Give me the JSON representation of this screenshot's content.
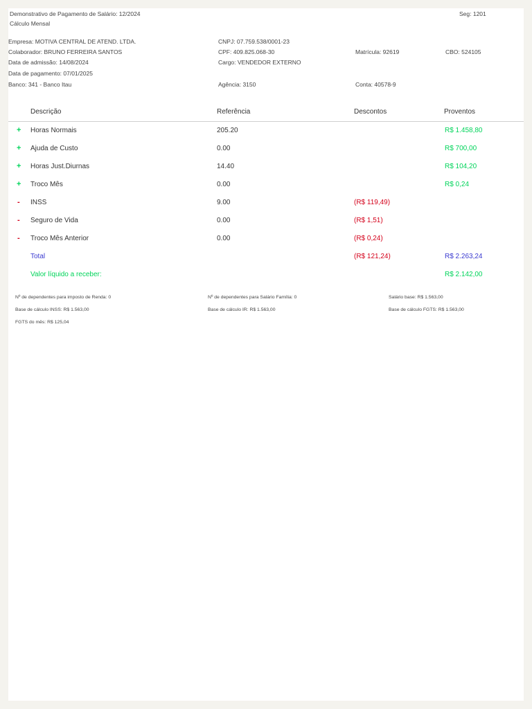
{
  "header": {
    "title": "Demonstrativo de Pagamento de Salário: 12/2024",
    "subtitle": "Cálculo Mensal",
    "seg": "Seg: 1201"
  },
  "info": {
    "empresa": "Empresa: MOTIVA CENTRAL DE ATEND. LTDA.",
    "cnpj": "CNPJ: 07.759.538/0001-23",
    "colaborador": "Colaborador: BRUNO FERREIRA SANTOS",
    "cpf": "CPF: 409.825.068-30",
    "matricula": "Matrícula: 92619",
    "cbo": "CBO: 524105",
    "admissao": "Data de admissão: 14/08/2024",
    "cargo": "Cargo: VENDEDOR EXTERNO",
    "pagamento": "Data de pagamento: 07/01/2025",
    "banco": "Banco: 341 - Banco Itau",
    "agencia": "Agência: 3150",
    "conta": "Conta: 40578-9"
  },
  "table": {
    "headers": {
      "descricao": "Descrição",
      "referencia": "Referência",
      "descontos": "Descontos",
      "proventos": "Proventos"
    },
    "rows": [
      {
        "sign": "+",
        "desc": "Horas Normais",
        "ref": "205.20",
        "desconto": "",
        "provento": "R$ 1.458,80"
      },
      {
        "sign": "+",
        "desc": "Ajuda de Custo",
        "ref": "0.00",
        "desconto": "",
        "provento": "R$ 700,00"
      },
      {
        "sign": "+",
        "desc": "Horas Just.Diurnas",
        "ref": "14.40",
        "desconto": "",
        "provento": "R$ 104,20"
      },
      {
        "sign": "+",
        "desc": "Troco Mês",
        "ref": "0.00",
        "desconto": "",
        "provento": "R$ 0,24"
      },
      {
        "sign": "-",
        "desc": "INSS",
        "ref": "9.00",
        "desconto": "(R$ 119,49)",
        "provento": ""
      },
      {
        "sign": "-",
        "desc": "Seguro de Vida",
        "ref": "0.00",
        "desconto": "(R$ 1,51)",
        "provento": ""
      },
      {
        "sign": "-",
        "desc": "Troco Mês Anterior",
        "ref": "0.00",
        "desconto": "(R$ 0,24)",
        "provento": ""
      }
    ],
    "total": {
      "label": "Total",
      "descontos": "(R$ 121,24)",
      "proventos": "R$ 2.263,24"
    },
    "liquido": {
      "label": "Valor líquido a receber:",
      "value": "R$ 2.142,00"
    }
  },
  "footer": {
    "dep_ir": "Nº de dependentes para imposto de Renda: 0",
    "dep_sf": "Nº de dependentes para Salário Família: 0",
    "salario_base": "Salário base: R$ 1.563,00",
    "base_inss": "Base de cálculo INSS: R$ 1.563,00",
    "base_ir": "Base de cálculo IR: R$ 1.563,00",
    "base_fgts": "Base de cálculo FGTS: R$ 1.563,00",
    "fgts_mes": "FGTS do mês: R$ 125,04"
  },
  "colors": {
    "positive": "#00d45a",
    "negative": "#d4001a",
    "total": "#3a3ad0"
  }
}
